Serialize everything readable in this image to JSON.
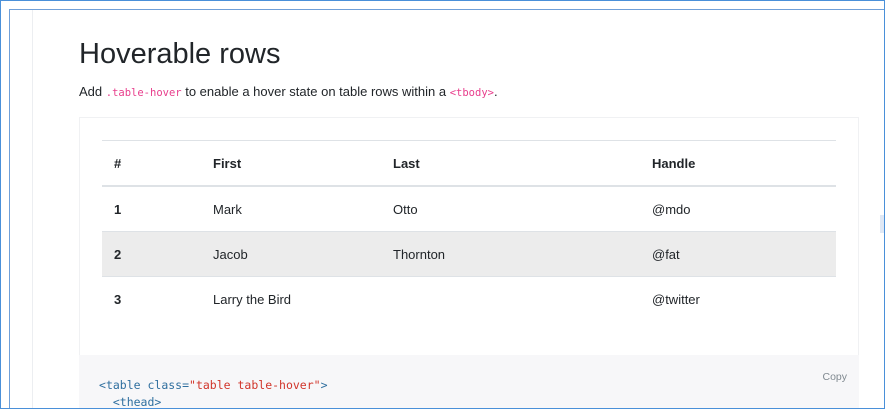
{
  "section": {
    "title": "Hoverable rows",
    "lead_prefix": "Add ",
    "lead_code": ".table-hover",
    "lead_middle": " to enable a hover state on table rows within a ",
    "lead_code2": "<tbody>",
    "lead_suffix": "."
  },
  "table": {
    "headers": [
      "#",
      "First",
      "Last",
      "Handle"
    ],
    "rows": [
      {
        "num": "1",
        "first": "Mark",
        "last": "Otto",
        "handle": "@mdo"
      },
      {
        "num": "2",
        "first": "Jacob",
        "last": "Thornton",
        "handle": "@fat"
      },
      {
        "num": "3",
        "first": "Larry the Bird",
        "last": "",
        "handle": "@twitter"
      }
    ],
    "hovered_row": 2,
    "hover_color": "#ececec"
  },
  "code_example": {
    "copy_label": "Copy",
    "line1_open": "<",
    "line1_tag": "table",
    "line1_attr": " class=",
    "line1_str": "\"table table-hover\"",
    "line1_close": ">",
    "line2": "  <thead>"
  },
  "colors": {
    "code_pink": "#e83e8c",
    "frame_blue": "#4a90d9",
    "code_bg": "#f7f7f9"
  }
}
